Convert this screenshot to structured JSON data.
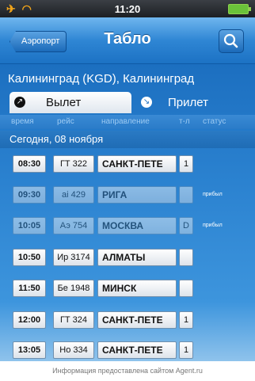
{
  "status_bar": {
    "time": "11:20",
    "signal_icons": "airplane-icon wifi-icon",
    "battery": "battery-icon"
  },
  "navbar": {
    "back_label": "Аэропорт",
    "title": "Табло",
    "search_icon": "search-icon"
  },
  "city": "Калининград (KGD), Калининград",
  "tabs": [
    {
      "label": "Вылет",
      "icon": "departure-arrow-icon",
      "active": true
    },
    {
      "label": "Прилет",
      "icon": "arrival-arrow-icon",
      "active": false
    }
  ],
  "columns": [
    "время",
    "рейс",
    "направление",
    "т-л",
    "статус"
  ],
  "date": "Сегодня, 08 ноября",
  "flights": [
    {
      "time": "08:30",
      "flight": "ГТ 322",
      "destination": "САНКТ-ПЕТЕ",
      "terminal": "1",
      "status": "",
      "faded": false
    },
    {
      "time": "09:30",
      "flight": "ai 429",
      "destination": "РИГА",
      "terminal": "",
      "status": "прибыл",
      "faded": true
    },
    {
      "time": "10:05",
      "flight": "Аэ 754",
      "destination": "МОСКВА",
      "terminal": "D",
      "status": "прибыл",
      "faded": true
    },
    {
      "time": "10:50",
      "flight": "Ир 3174",
      "destination": "АЛМАТЫ",
      "terminal": "",
      "status": "",
      "faded": false
    },
    {
      "time": "11:50",
      "flight": "Бе 1948",
      "destination": "МИНСК",
      "terminal": "",
      "status": "",
      "faded": false
    },
    {
      "time": "12:00",
      "flight": "ГТ 324",
      "destination": "САНКТ-ПЕТЕ",
      "terminal": "1",
      "status": "",
      "faded": false
    },
    {
      "time": "13:05",
      "flight": "Но 334",
      "destination": "САНКТ-ПЕТЕ",
      "terminal": "1",
      "status": "",
      "faded": false
    }
  ],
  "footer": "Информация предоставлена сайтом Agent.ru",
  "colors": {
    "nav_blue": "#2f86d4",
    "board_blue": "#1c6fc0",
    "accent_orange": "#f2a51a"
  }
}
